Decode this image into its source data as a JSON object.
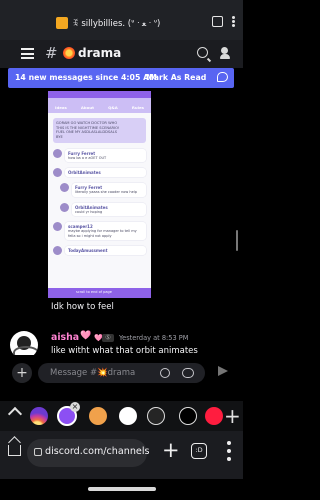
{
  "top_bar": {
    "title": "ꉂ sillybillies. (ᐡ ᐧ ﻌ ᐧ ᐡ)",
    "lock_icon": "lock-icon",
    "menu_icon": "more-vertical-icon"
  },
  "channel_header": {
    "menu_icon": "hamburger-icon",
    "hash_symbol": "#",
    "channel_name": "drama",
    "search_icon": "search-icon",
    "members_icon": "members-icon"
  },
  "new_messages_banner": {
    "text": "14 new messages since 4:05 AM",
    "action": "Mark As Read"
  },
  "screenshot_attachment": {
    "header_tabs": [
      "Ideas",
      "About",
      "Q&A",
      "Rules"
    ],
    "quote_lines": [
      "GORAM GO WATCH DOCTOR WHO",
      "THIS IS THE NIGHTTIME SCENARIO!",
      "FUEL ONE MY ASDLASLALDDSALS",
      "BYE"
    ],
    "posts": [
      {
        "author": "Furry Ferret",
        "text": "how ba a e aOET OUT"
      },
      {
        "author": "OrbitAnimates",
        "text": ""
      },
      {
        "author": "Furry Ferret",
        "text": "literally yaaas she cooder now help"
      },
      {
        "author": "OrbitAnimates",
        "text": "could yr hoping"
      },
      {
        "author": "scamper12",
        "text": "maybe applying for manager to tell my fella so i might not apply"
      },
      {
        "author": "TodayAmussment",
        "text": ""
      }
    ],
    "footer": "scroll to end of page"
  },
  "caption": "Idk how to feel",
  "message": {
    "author": "aisha",
    "heart": "🩷",
    "badge": "🩷",
    "badge_label": "Ⓢ",
    "timestamp": "Yesterday at 8:53 PM",
    "text": "like witht what that orbit animates"
  },
  "composer": {
    "placeholder": "Message #💥drama",
    "plus_icon": "plus-icon",
    "emoji_icon": "emoji-icon",
    "gamepad_icon": "gamepad-icon",
    "send_icon": "send-icon"
  },
  "browser": {
    "tabs_strip_chevron": "chevron-up-icon",
    "tab_icons": [
      "instagram-icon",
      "discord-icon",
      "brave-icon",
      "reddit-icon",
      "dark-app-icon",
      "x-icon",
      "red-app-icon"
    ],
    "add_tab": "+",
    "url": "discord.com/channels",
    "new_tab": "+",
    "tab_count": ":D",
    "menu": "more-vertical-icon"
  },
  "colors": {
    "accent": "#5865f2",
    "background": "#000000",
    "author": "#ff83d2"
  }
}
